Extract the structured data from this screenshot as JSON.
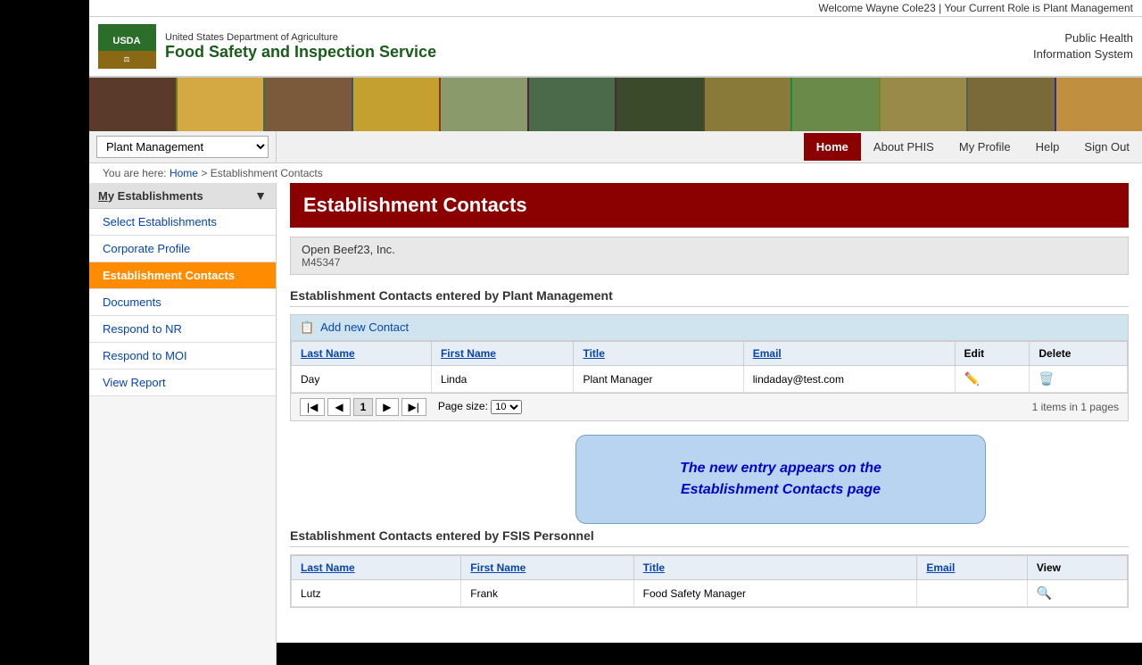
{
  "topbar": {
    "welcome_text": "Welcome Wayne Cole23  |  Your Current Role is Plant Management"
  },
  "header": {
    "usda_label": "USDA",
    "dept_name": "United States Department of Agriculture",
    "agency_name": "Food Safety and Inspection Service",
    "phis_line1": "Public Health",
    "phis_line2": "Information System"
  },
  "nav": {
    "module_selected": "Plant Management",
    "links": [
      {
        "label": "Home",
        "active": true
      },
      {
        "label": "About PHIS",
        "active": false
      },
      {
        "label": "My Profile",
        "active": false
      },
      {
        "label": "Help",
        "active": false
      },
      {
        "label": "Sign Out",
        "active": false
      }
    ]
  },
  "breadcrumb": {
    "prefix": "You are here:",
    "home": "Home",
    "separator": ">",
    "current": "Establishment Contacts"
  },
  "sidebar": {
    "title": "My Establishments",
    "items": [
      {
        "label": "Select Establishments",
        "active": false
      },
      {
        "label": "Corporate Profile",
        "active": false
      },
      {
        "label": "Establishment Contacts",
        "active": true
      },
      {
        "label": "Documents",
        "active": false
      },
      {
        "label": "Respond to NR",
        "active": false
      },
      {
        "label": "Respond to MOI",
        "active": false
      },
      {
        "label": "View Report",
        "active": false
      }
    ]
  },
  "page": {
    "title": "Establishment Contacts",
    "establishment_name": "Open Beef23, Inc.",
    "establishment_id": "M45347",
    "section1_header": "Establishment Contacts entered by Plant Management",
    "add_contact_label": "Add new Contact",
    "table1": {
      "columns": [
        "Last Name",
        "First Name",
        "Title",
        "Email",
        "Edit",
        "Delete"
      ],
      "rows": [
        {
          "last_name": "Day",
          "first_name": "Linda",
          "title": "Plant Manager",
          "email": "lindaday@test.com"
        }
      ]
    },
    "pagination": {
      "page_number": "1",
      "page_size_label": "Page size:",
      "page_size_value": "10",
      "items_info": "1 items in 1 pages"
    },
    "tooltip": {
      "line1": "The new entry appears on the",
      "line2": "Establishment Contacts page"
    },
    "section2_header": "Establishment Contacts entered by FSIS Personnel",
    "table2": {
      "columns": [
        "Last Name",
        "First Name",
        "Title",
        "Email",
        "View"
      ],
      "rows": [
        {
          "last_name": "Lutz",
          "first_name": "Frank",
          "title": "Food Safety Manager",
          "email": ""
        }
      ]
    }
  }
}
